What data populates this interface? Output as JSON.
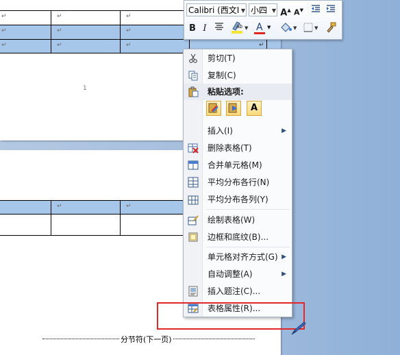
{
  "document": {
    "page_number": "1",
    "cell_mark": "↵",
    "section_break_label": "分节符(下一页)"
  },
  "mini_toolbar": {
    "font_name": "Calibri (西文I",
    "font_size": "小四",
    "grow_font": "A",
    "shrink_font": "A",
    "bold": "B",
    "italic": "I",
    "font_color_label": "A",
    "font_color": "#e0261f",
    "highlight_color": "#f5e532"
  },
  "context_menu": {
    "items": [
      {
        "label": "剪切(T)",
        "icon": "scissors-icon"
      },
      {
        "label": "复制(C)",
        "icon": "copy-icon"
      },
      {
        "label": "粘贴选项:",
        "icon": "paste-icon"
      },
      {
        "label": "插入(I)",
        "icon": "",
        "submenu": true
      },
      {
        "label": "删除表格(T)",
        "icon": "delete-table-icon"
      },
      {
        "label": "合并单元格(M)",
        "icon": "merge-cells-icon"
      },
      {
        "label": "平均分布各行(N)",
        "icon": "distribute-rows-icon"
      },
      {
        "label": "平均分布各列(Y)",
        "icon": "distribute-columns-icon"
      },
      {
        "label": "绘制表格(W)",
        "icon": "draw-table-icon"
      },
      {
        "label": "边框和底纹(B)...",
        "icon": "borders-shading-icon"
      },
      {
        "label": "单元格对齐方式(G)",
        "icon": "",
        "submenu": true
      },
      {
        "label": "自动调整(A)",
        "icon": "",
        "submenu": true
      },
      {
        "label": "插入题注(C)...",
        "icon": "insert-caption-icon"
      },
      {
        "label": "表格属性(R)...",
        "icon": "table-properties-icon"
      }
    ],
    "paste_options": [
      "keep-source-formatting",
      "merge-formatting",
      "keep-text-only"
    ],
    "paste_text_only_label": "A"
  },
  "annotation": {
    "highlight_color": "#e32626"
  }
}
